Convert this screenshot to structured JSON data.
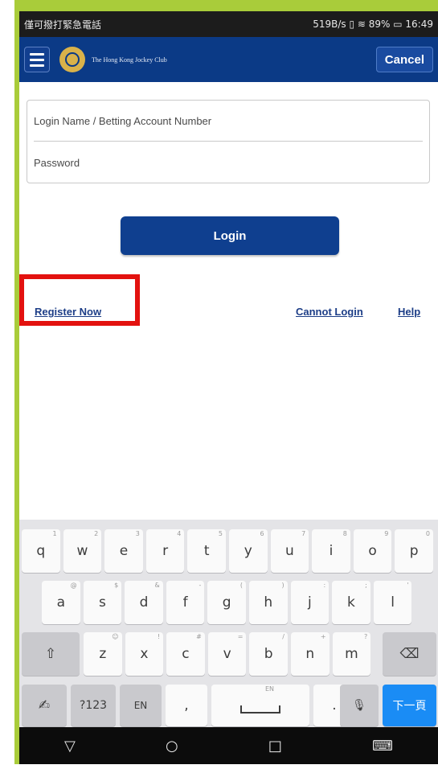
{
  "status_bar": {
    "left_text": "僅可撥打緊急電話",
    "right_text": "519B/s",
    "battery": "89%",
    "time": "16:49"
  },
  "app_bar": {
    "logo_text": "The Hong Kong Jockey Club",
    "cancel_label": "Cancel"
  },
  "login_form": {
    "username_placeholder": "Login Name / Betting Account Number",
    "password_placeholder": "Password",
    "login_label": "Login"
  },
  "links": {
    "register": "Register Now",
    "cannot_login": "Cannot Login",
    "help": "Help"
  },
  "keyboard": {
    "row1": [
      {
        "label": "q",
        "hint": "1"
      },
      {
        "label": "w",
        "hint": "2"
      },
      {
        "label": "e",
        "hint": "3"
      },
      {
        "label": "r",
        "hint": "4"
      },
      {
        "label": "t",
        "hint": "5"
      },
      {
        "label": "y",
        "hint": "6"
      },
      {
        "label": "u",
        "hint": "7"
      },
      {
        "label": "i",
        "hint": "8"
      },
      {
        "label": "o",
        "hint": "9"
      },
      {
        "label": "p",
        "hint": "0"
      }
    ],
    "row2": [
      {
        "label": "a",
        "hint": "@"
      },
      {
        "label": "s",
        "hint": "$"
      },
      {
        "label": "d",
        "hint": "&"
      },
      {
        "label": "f",
        "hint": "-"
      },
      {
        "label": "g",
        "hint": "("
      },
      {
        "label": "h",
        "hint": ")"
      },
      {
        "label": "j",
        "hint": ":"
      },
      {
        "label": "k",
        "hint": ";"
      },
      {
        "label": "l",
        "hint": "'"
      }
    ],
    "row3": [
      {
        "label": "z",
        "hint": "☺"
      },
      {
        "label": "x",
        "hint": "!"
      },
      {
        "label": "c",
        "hint": "#"
      },
      {
        "label": "v",
        "hint": "="
      },
      {
        "label": "b",
        "hint": "/"
      },
      {
        "label": "n",
        "hint": "+"
      },
      {
        "label": "m",
        "hint": "?"
      }
    ],
    "shift": "⇧",
    "backspace": "⌫",
    "gesture": "✍",
    "symbols": "?123",
    "lang": "EN",
    "comma": ",",
    "space_hint": "EN",
    "period": ".",
    "mic": "🎙",
    "enter": "下一頁"
  },
  "nav_bar": {
    "back": "▽",
    "home": "○",
    "recents": "□",
    "keyboard": "⌨"
  }
}
